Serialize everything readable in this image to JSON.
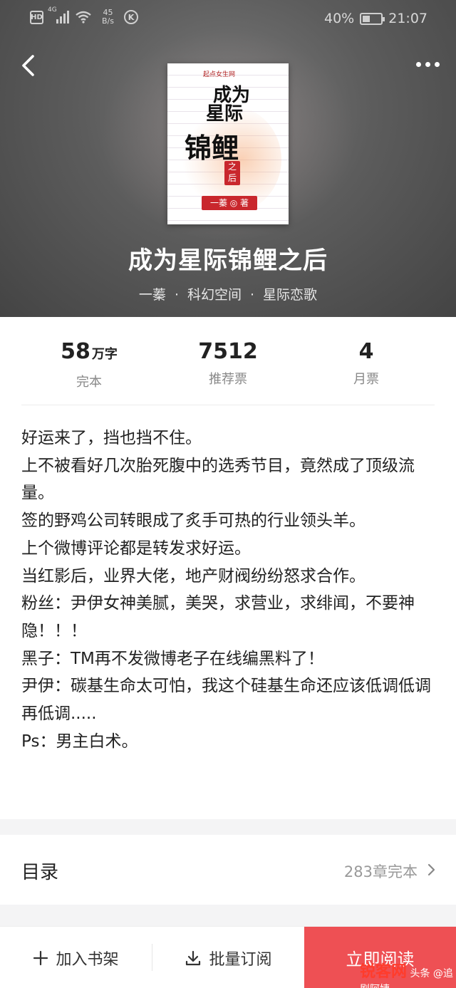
{
  "status_bar": {
    "network": "4G",
    "speed_value": "45",
    "speed_unit": "B/s",
    "k_icon": "K",
    "hd_badge": "HD",
    "battery": "40%",
    "battery_level": 0.4,
    "time": "21:07"
  },
  "header": {
    "back_icon": "chevron-left-icon",
    "more_icon": "more-dots-icon"
  },
  "cover": {
    "brand": "起点女生网",
    "title_lines": [
      "成为",
      "星际"
    ],
    "title_big": "锦鲤",
    "seal": "之后",
    "author_tag": "一蓁 ◎ 著"
  },
  "book": {
    "title": "成为星际锦鲤之后",
    "author": "一蓁",
    "category": "科幻空间",
    "subcategory": "星际恋歌"
  },
  "stats": [
    {
      "number": "58",
      "unit": "万字",
      "label": "完本"
    },
    {
      "number": "7512",
      "unit": "",
      "label": "推荐票"
    },
    {
      "number": "4",
      "unit": "",
      "label": "月票"
    }
  ],
  "synopsis": [
    "好运来了，挡也挡不住。",
    "上不被看好几次胎死腹中的选秀节目，竟然成了顶级流量。",
    "签的野鸡公司转眼成了炙手可热的行业领头羊。",
    "上个微博评论都是转发求好运。",
    "当红影后，业界大佬，地产财阀纷纷怒求合作。",
    "粉丝：尹伊女神美腻，美哭，求营业，求绯闻，不要神隐！！！",
    "黑子：TM再不发微博老子在线编黑料了！",
    "尹伊：碳基生命太可怕，我这个硅基生命还应该低调低调再低调.....",
    "Ps：男主白术。"
  ],
  "toc": {
    "title": "目录",
    "status": "283章完本",
    "arrow_icon": "chevron-right-icon"
  },
  "bottom_bar": {
    "shelf_label": "加入书架",
    "shelf_icon": "plus-icon",
    "subscribe_label": "批量订阅",
    "subscribe_icon": "download-icon",
    "read_label": "立即阅读",
    "read_color": "#ee5054"
  },
  "watermark": {
    "brand": "锐客网",
    "text": "头条 @追剧阿姨"
  }
}
